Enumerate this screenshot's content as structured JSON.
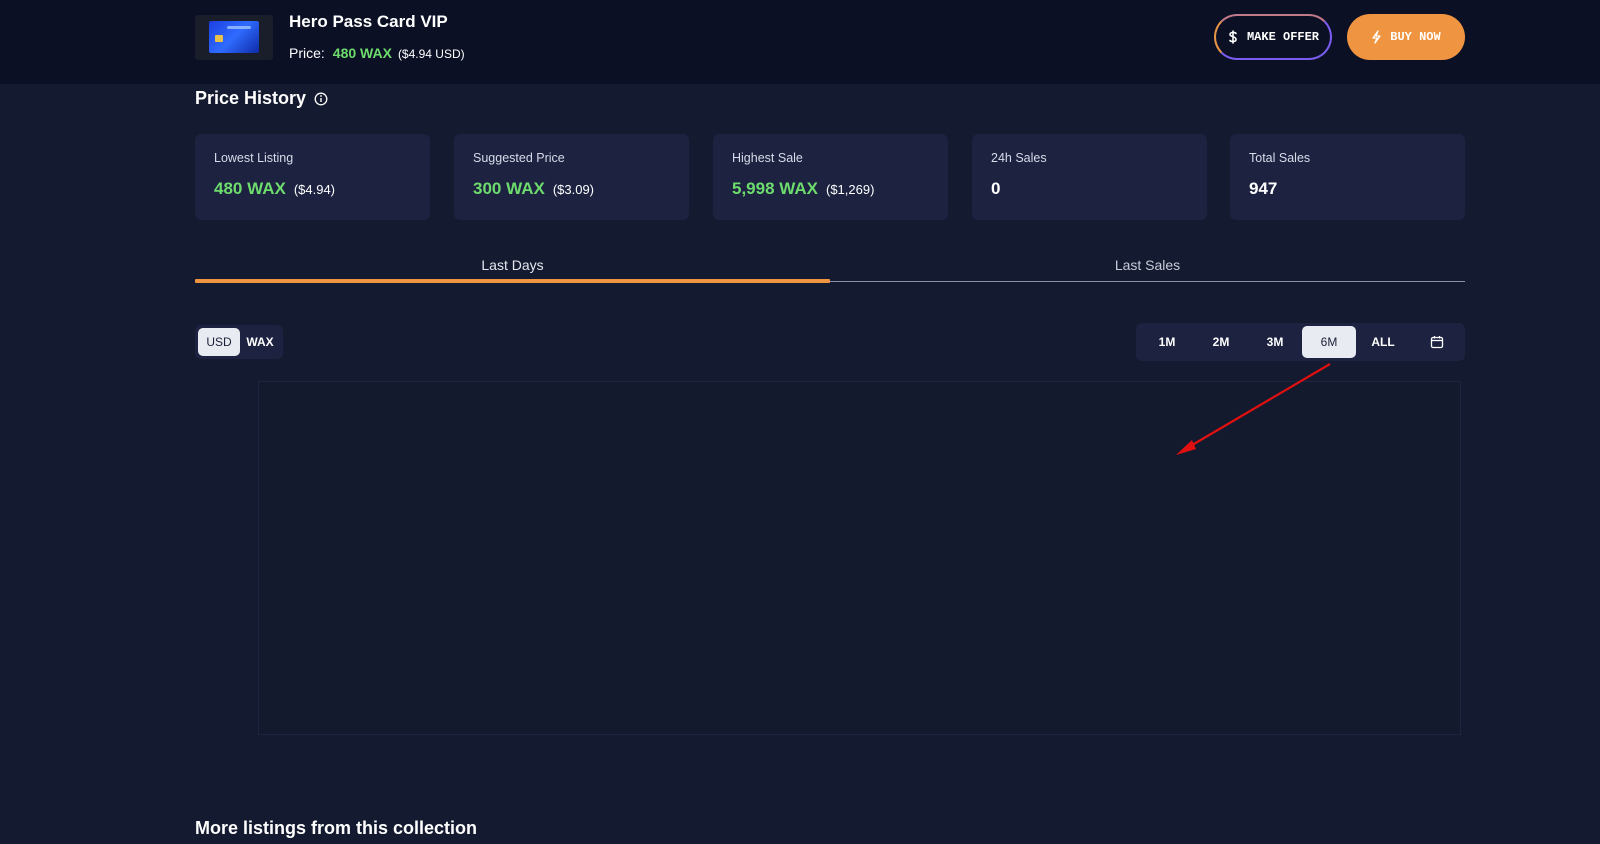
{
  "header": {
    "item_title": "Hero Pass Card VIP",
    "price_label": "Price:",
    "price_wax": "480 WAX",
    "price_usd": "($4.94 USD)",
    "make_offer_label": "MAKE OFFER",
    "buy_now_label": "BUY NOW"
  },
  "price_history": {
    "title": "Price History",
    "stats": [
      {
        "label": "Lowest Listing",
        "value": "480 WAX",
        "sub": "($4.94)"
      },
      {
        "label": "Suggested Price",
        "value": "300 WAX",
        "sub": "($3.09)"
      },
      {
        "label": "Highest Sale",
        "value": "5,998 WAX",
        "sub": "($1,269)"
      },
      {
        "label": "24h Sales",
        "value": "0",
        "sub": ""
      },
      {
        "label": "Total Sales",
        "value": "947",
        "sub": ""
      }
    ]
  },
  "tabs": {
    "last_days": "Last Days",
    "last_sales": "Last Sales",
    "active": "Last Days"
  },
  "currency_toggle": {
    "usd": "USD",
    "wax": "WAX",
    "selected": "USD"
  },
  "ranges": {
    "items": [
      "1M",
      "2M",
      "3M",
      "6M",
      "ALL"
    ],
    "selected": "6M"
  },
  "more_listings_title": "More listings from this collection",
  "colors": {
    "accent_orange": "#ef9440",
    "price_green": "#6ddc6d",
    "annotation_red": "#e01010"
  }
}
